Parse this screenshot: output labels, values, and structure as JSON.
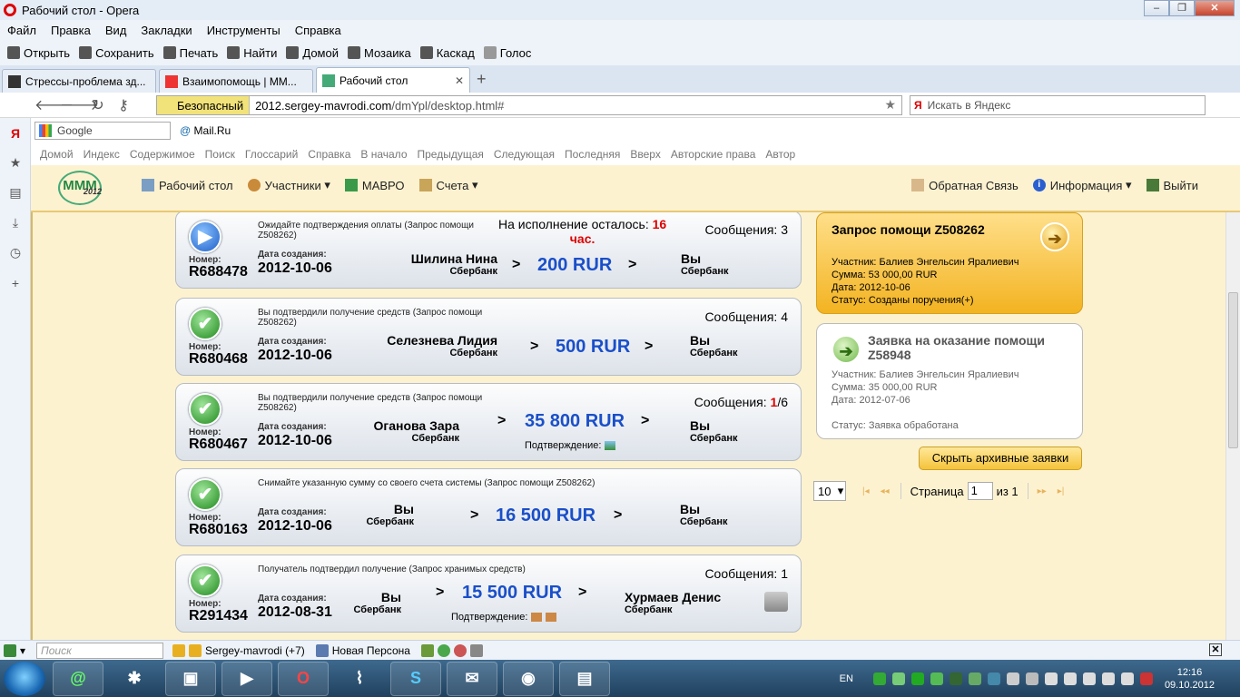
{
  "window": {
    "title": "Рабочий стол - Opera"
  },
  "menu": [
    "Файл",
    "Правка",
    "Вид",
    "Закладки",
    "Инструменты",
    "Справка"
  ],
  "toolbar": [
    "Открыть",
    "Сохранить",
    "Печать",
    "Найти",
    "Домой",
    "Мозаика",
    "Каскад",
    "Голос"
  ],
  "tabs": [
    {
      "label": "Стрессы-проблема зд..."
    },
    {
      "label": "Взаимопомощь | ММ..."
    },
    {
      "label": "Рабочий стол"
    }
  ],
  "address": {
    "secure_label": "Безопасный",
    "url_host": "2012.sergey-mavrodi.com",
    "url_path": "/dmYpl/desktop.html#"
  },
  "search": {
    "placeholder": "Искать в Яндекс"
  },
  "bookmarks": {
    "google": "Google",
    "mailru": "Mail.Ru"
  },
  "nav_links": [
    "Домой",
    "Индекс",
    "Содержимое",
    "Поиск",
    "Глоссарий",
    "Справка",
    "В начало",
    "Предыдущая",
    "Следующая",
    "Последняя",
    "Вверх",
    "Авторские права",
    "Автор"
  ],
  "site": {
    "logo_text": "МММ",
    "logo_year": "2012",
    "nav": [
      "Рабочий стол",
      "Участники",
      "МАВРО",
      "Счета"
    ],
    "nav_right": [
      "Обратная Связь",
      "Информация",
      "Выйти"
    ]
  },
  "labels": {
    "number": "Номер:",
    "created": "Дата создания:",
    "messages": "Сообщения:",
    "confirmation": "Подтверждение:",
    "remaining": "На исполнение осталось:",
    "hours": "час.",
    "arrow": ">"
  },
  "cards": [
    {
      "desc": "Ожидайте подтверждения оплаты (Запрос помощи Z508262)",
      "number": "R688478",
      "date": "2012-10-06",
      "from": "Шилина Нина",
      "from_bank": "Сбербанк",
      "amount": "200 RUR",
      "to": "Вы",
      "to_bank": "Сбербанк",
      "messages": "3",
      "remaining": "16"
    },
    {
      "desc": "Вы подтвердили получение средств (Запрос помощи Z508262)",
      "number": "R680468",
      "date": "2012-10-06",
      "from": "Селезнева Лидия",
      "from_bank": "Сбербанк",
      "amount": "500 RUR",
      "to": "Вы",
      "to_bank": "Сбербанк",
      "messages": "4"
    },
    {
      "desc": "Вы подтвердили получение средств (Запрос помощи Z508262)",
      "number": "R680467",
      "date": "2012-10-06",
      "from": "Оганова Зара",
      "from_bank": "Сбербанк",
      "amount": "35 800 RUR",
      "to": "Вы",
      "to_bank": "Сбербанк",
      "messages_new": "1",
      "messages_total": "/6"
    },
    {
      "desc": "Снимайте указанную сумму со своего счета системы (Запрос помощи Z508262)",
      "number": "R680163",
      "date": "2012-10-06",
      "from": "Вы",
      "from_bank": "Сбербанк",
      "amount": "16 500 RUR",
      "to": "Вы",
      "to_bank": "Сбербанк"
    },
    {
      "desc": "Получатель подтвердил получение (Запрос хранимых средств)",
      "number": "R291434",
      "date": "2012-08-31",
      "from": "Вы",
      "from_bank": "Сбербанк",
      "amount": "15 500 RUR",
      "to": "Хурмаев Денис",
      "to_bank": "Сбербанк",
      "messages": "1"
    }
  ],
  "requests": [
    {
      "title": "Запрос помощи Z508262",
      "participant": "Участник: Балиев Энгельсин Яралиевич",
      "sum": "Сумма: 53 000,00 RUR",
      "date": "Дата: 2012-10-06",
      "status": "Статус: Созданы поручения(+)"
    },
    {
      "title": "Заявка на оказание помощи Z58948",
      "participant": "Участник: Балиев Энгельсин Яралиевич",
      "sum": "Сумма: 35 000,00 RUR",
      "date": "Дата: 2012-07-06",
      "status": "Статус: Заявка обработана"
    }
  ],
  "archive_button": "Скрыть архивные заявки",
  "pager": {
    "per_page": "10",
    "page_label": "Страница",
    "page": "1",
    "of_label": "из 1"
  },
  "statusbar": {
    "search_placeholder": "Поиск",
    "friends": "Sergey-mavrodi (+7)",
    "persona": "Новая Персона"
  },
  "tray": {
    "lang": "EN",
    "time": "12:16",
    "date": "09.10.2012"
  },
  "colors": {
    "accent_amount": "#1a4fc9",
    "warn": "#dd0000",
    "header_bg": "#fdf2d0",
    "gold": "#f3b321"
  }
}
